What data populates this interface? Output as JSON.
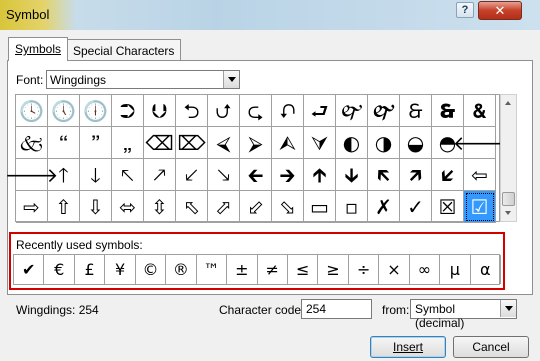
{
  "window": {
    "title": "Symbol",
    "help_label": "?",
    "close_label": "✕"
  },
  "tabs": [
    {
      "label": "Symbols",
      "active": true
    },
    {
      "label": "Special Characters",
      "active": false
    }
  ],
  "font": {
    "label": "Font:",
    "value": "Wingdings"
  },
  "symbol_grid": {
    "rows": [
      [
        "🕓",
        "🕔",
        "🕕",
        "⮊",
        "⮋",
        "⮌",
        "⮍",
        "⮎",
        "⮏",
        "⮐",
        "🙰",
        "🙱",
        "🙲",
        "🙳",
        "🙴"
      ],
      [
        "🙵",
        "🙶",
        "🙷",
        "🙸",
        "⌫",
        "⌦",
        "⮘",
        "⮚",
        "⮙",
        "⮛",
        "◐",
        "◑",
        "◒",
        "◓",
        "🡐"
      ],
      [
        "🡒",
        "🡑",
        "🡓",
        "🡔",
        "🡕",
        "🡗",
        "🡖",
        "🡰",
        "🡲",
        "🡱",
        "🡳",
        "🡴",
        "🡵",
        "🡷",
        "⇦"
      ],
      [
        "⇨",
        "⇧",
        "⇩",
        "⬄",
        "⇳",
        "⬁",
        "⬀",
        "⬃",
        "⬂",
        "▭",
        "▫",
        "✗",
        "✓",
        "☒",
        "☑"
      ]
    ],
    "selected": {
      "row": 3,
      "col": 14
    }
  },
  "recent": {
    "label": "Recently used symbols:",
    "symbols": [
      "✔",
      "€",
      "£",
      "¥",
      "©",
      "®",
      "™",
      "±",
      "≠",
      "≤",
      "≥",
      "÷",
      "×",
      "∞",
      "µ",
      "α"
    ]
  },
  "status": {
    "font_code_label": "Wingdings: 254",
    "char_code_label": "Character code:",
    "char_code_value": "254",
    "from_label": "from:",
    "from_value": "Symbol (decimal)"
  },
  "buttons": {
    "insert": "Insert",
    "cancel": "Cancel"
  },
  "colors": {
    "highlight_border": "#d40000",
    "selection": "#3399ff"
  }
}
